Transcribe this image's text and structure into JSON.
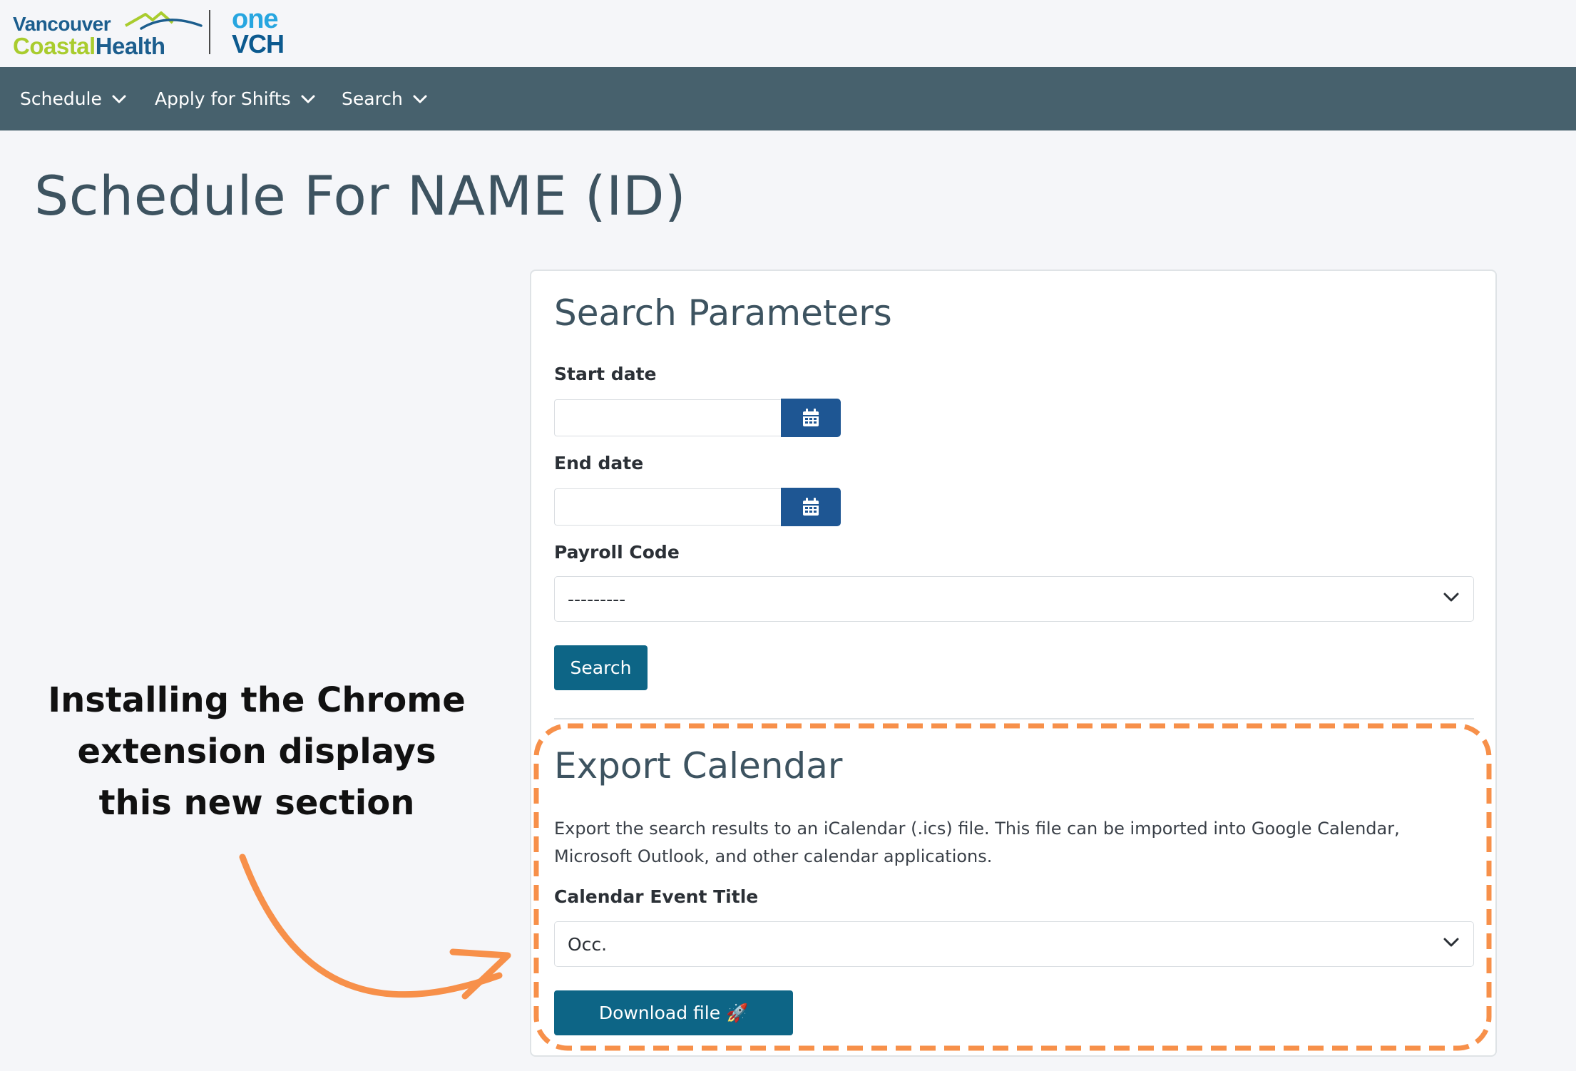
{
  "logo": {
    "line1": "Vancouver",
    "line2a": "Coastal",
    "line2b": "Health",
    "one": "one",
    "vch": "VCH"
  },
  "nav": {
    "items": [
      {
        "label": "Schedule",
        "icon": "chevron-down-icon"
      },
      {
        "label": "Apply for Shifts",
        "icon": "chevron-down-icon"
      },
      {
        "label": "Search",
        "icon": "chevron-down-icon"
      }
    ]
  },
  "page": {
    "title": "Schedule For NAME (ID)"
  },
  "search_params": {
    "heading": "Search Parameters",
    "start_label": "Start date",
    "start_value": "",
    "end_label": "End date",
    "end_value": "",
    "payroll_label": "Payroll Code",
    "payroll_value": "---------",
    "search_button": "Search"
  },
  "export": {
    "heading": "Export Calendar",
    "description": "Export the search results to an iCalendar (.ics) file. This file can be imported into Google Calendar, Microsoft Outlook, and other calendar applications.",
    "event_title_label": "Calendar Event Title",
    "event_title_value": "Occ.",
    "download_button": "Download file 🚀"
  },
  "annotation": {
    "lines": [
      "Installing the Chrome",
      "extension displays",
      "this new section"
    ]
  },
  "colors": {
    "nav_bg": "#47616d",
    "primary_button": "#0d6586",
    "calendar_button": "#1e5693",
    "highlight_dash": "#f7904a",
    "heading": "#3d5360"
  }
}
